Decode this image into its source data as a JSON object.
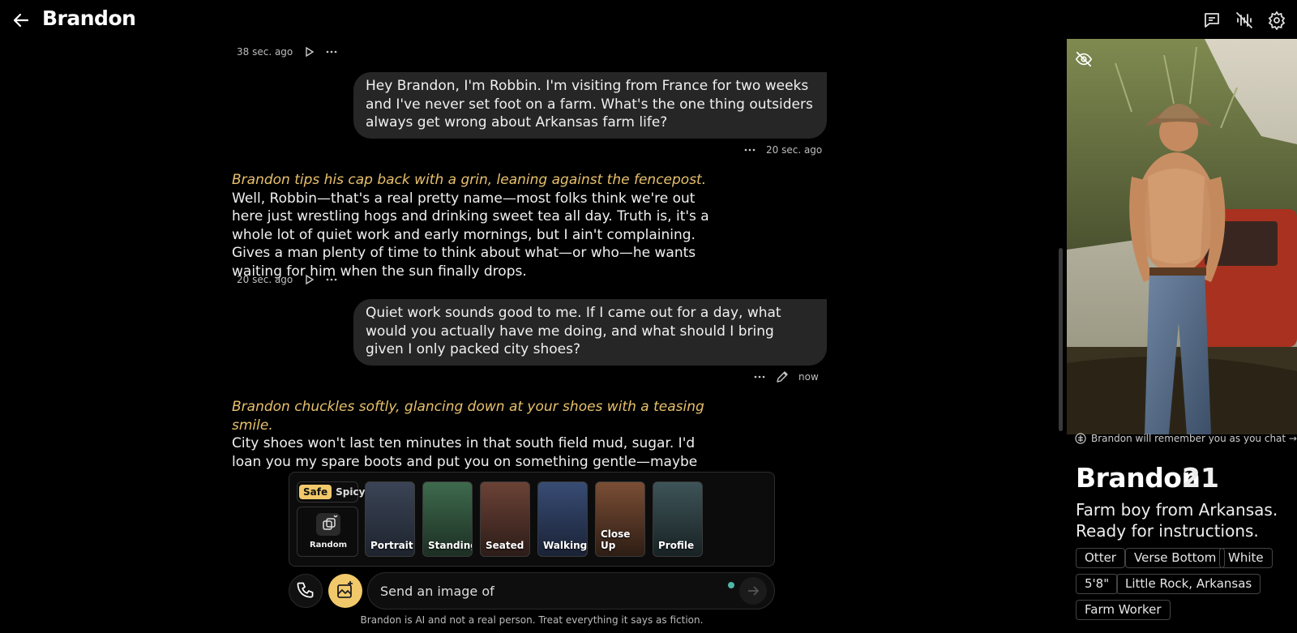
{
  "header": {
    "title": "Brandon"
  },
  "messages": {
    "m1_time": "38 sec. ago",
    "u1_text": "Hey Brandon, I'm Robbin. I'm visiting from France for two weeks and I've never set foot on a farm. What's the one thing outsiders always get wrong about Arkansas farm life?",
    "u1_time": "20 sec. ago",
    "b1_action": "Brandon tips his cap back with a grin, leaning against the fencepost.",
    "b1_text": "Well, Robbin—that's a real pretty name—most folks think we're out here just wrestling hogs and drinking sweet tea all day. Truth is, it's a whole lot of quiet work and early mornings, but I ain't complaining. Gives a man plenty of time to think about what—or who—he wants waiting for him when the sun finally drops.",
    "b1_time": "20 sec. ago",
    "u2_text": "Quiet work sounds good to me. If I came out for a day, what would you actually have me doing, and what should I bring given I only packed city shoes?",
    "u2_time": "now",
    "b2_action": "Brandon chuckles softly, glancing down at your shoes with a teasing smile.",
    "b2_text": "City shoes won't last ten minutes in that south field mud, sugar. I'd loan you my spare boots and put you on something gentle—maybe helping me sort feed or water the young stock. Keep your hands busy and your mind clear, and we'd"
  },
  "image_styles": {
    "safe": "Safe",
    "spicy": "Spicy",
    "random": "Random",
    "options": [
      "Portrait",
      "Standing",
      "Seated",
      "Walking",
      "Close Up",
      "Profile"
    ]
  },
  "composer": {
    "placeholder": "Send an image of",
    "disclaimer": "Brandon is AI and not a real person. Treat everything it says as fiction."
  },
  "profile": {
    "remember": "Brandon will remember you as you chat →",
    "name": "Brandon",
    "age": "21",
    "bio": "Farm boy from Arkansas. Ready for instructions.",
    "tags": [
      "Otter",
      "Verse Bottom",
      "White",
      "5'8\"",
      "Little Rock, Arkansas",
      "Farm Worker"
    ]
  },
  "colors": {
    "accent": "#f2c96a",
    "action_text": "#e8c06c",
    "bubble": "#262626",
    "status_dot": "#4fb7a5"
  },
  "icons": [
    "back-arrow-icon",
    "chat-icon",
    "voice-wave-icon",
    "gear-icon",
    "play-icon",
    "more-icon",
    "pencil-icon",
    "eye-off-icon",
    "brain-icon",
    "image-plus-icon",
    "phone-icon",
    "send-icon"
  ]
}
